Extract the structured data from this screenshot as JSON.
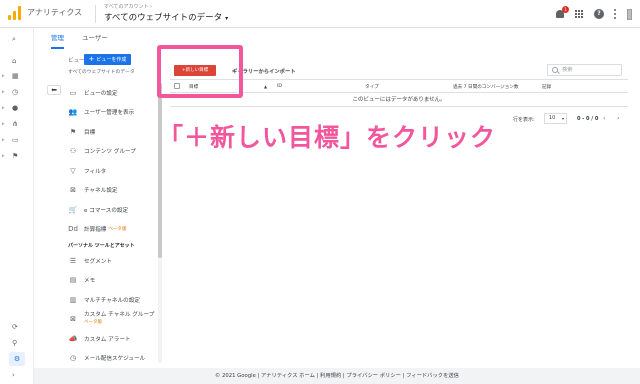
{
  "header": {
    "app_name": "アナリティクス",
    "account_sub": "すべてのアカウント › ",
    "account_main": "すべてのウェブサイトのデータ",
    "caret": "▾",
    "notification_count": "1",
    "help_glyph": "?"
  },
  "nav_icons": [
    {
      "name": "search-icon",
      "glyph": "⌕",
      "arrow": ""
    },
    {
      "name": "home-icon",
      "glyph": "⌂",
      "arrow": ""
    },
    {
      "name": "dashboard-icon",
      "glyph": "▦",
      "arrow": "▸"
    },
    {
      "name": "clock-icon",
      "glyph": "◷",
      "arrow": "▸"
    },
    {
      "name": "person-icon",
      "glyph": "●",
      "arrow": "▸"
    },
    {
      "name": "acquisition-icon",
      "glyph": "⋔",
      "arrow": "▸"
    },
    {
      "name": "behavior-icon",
      "glyph": "▭",
      "arrow": "▸"
    },
    {
      "name": "flag-icon",
      "glyph": "⚑",
      "arrow": "▸"
    }
  ],
  "nav_bottom": {
    "attribution_glyph": "⟳",
    "discover_glyph": "⚲",
    "settings_glyph": "⚙",
    "expand_glyph": "›"
  },
  "tabs": {
    "admin": "管理",
    "user": "ユーザー"
  },
  "view": {
    "label": "ビュー",
    "create_plus": "+",
    "create_label": "ビューを作成",
    "selected": "すべてのウェブサイトのデータ",
    "back_glyph": "⬅"
  },
  "menu": [
    {
      "name": "menu-view-settings",
      "icon": "▭",
      "label": "ビューの設定",
      "beta": ""
    },
    {
      "name": "menu-user-management",
      "icon": "👥",
      "label": "ユーザー管理を表示",
      "beta": ""
    },
    {
      "name": "menu-goals",
      "icon": "⚑",
      "label": "目標",
      "beta": ""
    },
    {
      "name": "menu-content-grouping",
      "icon": "⚇",
      "label": "コンテンツ グループ",
      "beta": ""
    },
    {
      "name": "menu-filters",
      "icon": "▽",
      "label": "フィルタ",
      "beta": ""
    },
    {
      "name": "menu-channel-settings",
      "icon": "⊠",
      "label": "チャネル設定",
      "beta": ""
    },
    {
      "name": "menu-ecommerce",
      "icon": "🛒",
      "label": "e コマースの設定",
      "beta": ""
    },
    {
      "name": "menu-calculated-metrics",
      "icon": "Dd",
      "label": "計算指標",
      "beta": "ベータ版"
    }
  ],
  "section_personal": "パーソナル ツールとアセット",
  "menu2": [
    {
      "name": "menu-segments",
      "icon": "☰",
      "label": "セグメント",
      "beta": ""
    },
    {
      "name": "menu-annotations",
      "icon": "▤",
      "label": "メモ",
      "beta": ""
    },
    {
      "name": "menu-multichannel",
      "icon": "▥",
      "label": "マルチチャネルの設定",
      "beta": ""
    },
    {
      "name": "menu-custom-channel-grouping",
      "icon": "⊠",
      "label": "カスタム チャネル グループ",
      "beta": "ベータ版"
    },
    {
      "name": "menu-custom-alerts",
      "icon": "📣",
      "label": "カスタム アラート",
      "beta": ""
    },
    {
      "name": "menu-scheduled-emails",
      "icon": "◷",
      "label": "メール配信スケジュール",
      "beta": ""
    }
  ],
  "toolbar": {
    "new_goal": "+新しい目標",
    "import": "ギャラリーからインポート",
    "search_placeholder": "検索"
  },
  "table": {
    "col_goal": "目標",
    "col_sort": "▲",
    "col_id": "ID",
    "col_type": "タイプ",
    "col_conversions": "過去 7 日間のコンバージョン数",
    "col_record": "記録",
    "empty": "このビューにはデータがありません。"
  },
  "pager": {
    "rows_label": "行を表示:",
    "rows_value": "10",
    "caret": "▾",
    "range": "0 - 0 / 0",
    "prev": "‹",
    "next": "›"
  },
  "callout": "「＋新しい目標」をクリック",
  "footer": "© 2021 Google | アナリティクス ホーム | 利用規約 | プライバシー ポリシー | フィードバックを送信",
  "colors": {
    "accent_blue": "#1a73e8",
    "new_goal_red": "#db4437",
    "callout_pink": "#f2579e",
    "logo_orange": "#f9ab00"
  }
}
